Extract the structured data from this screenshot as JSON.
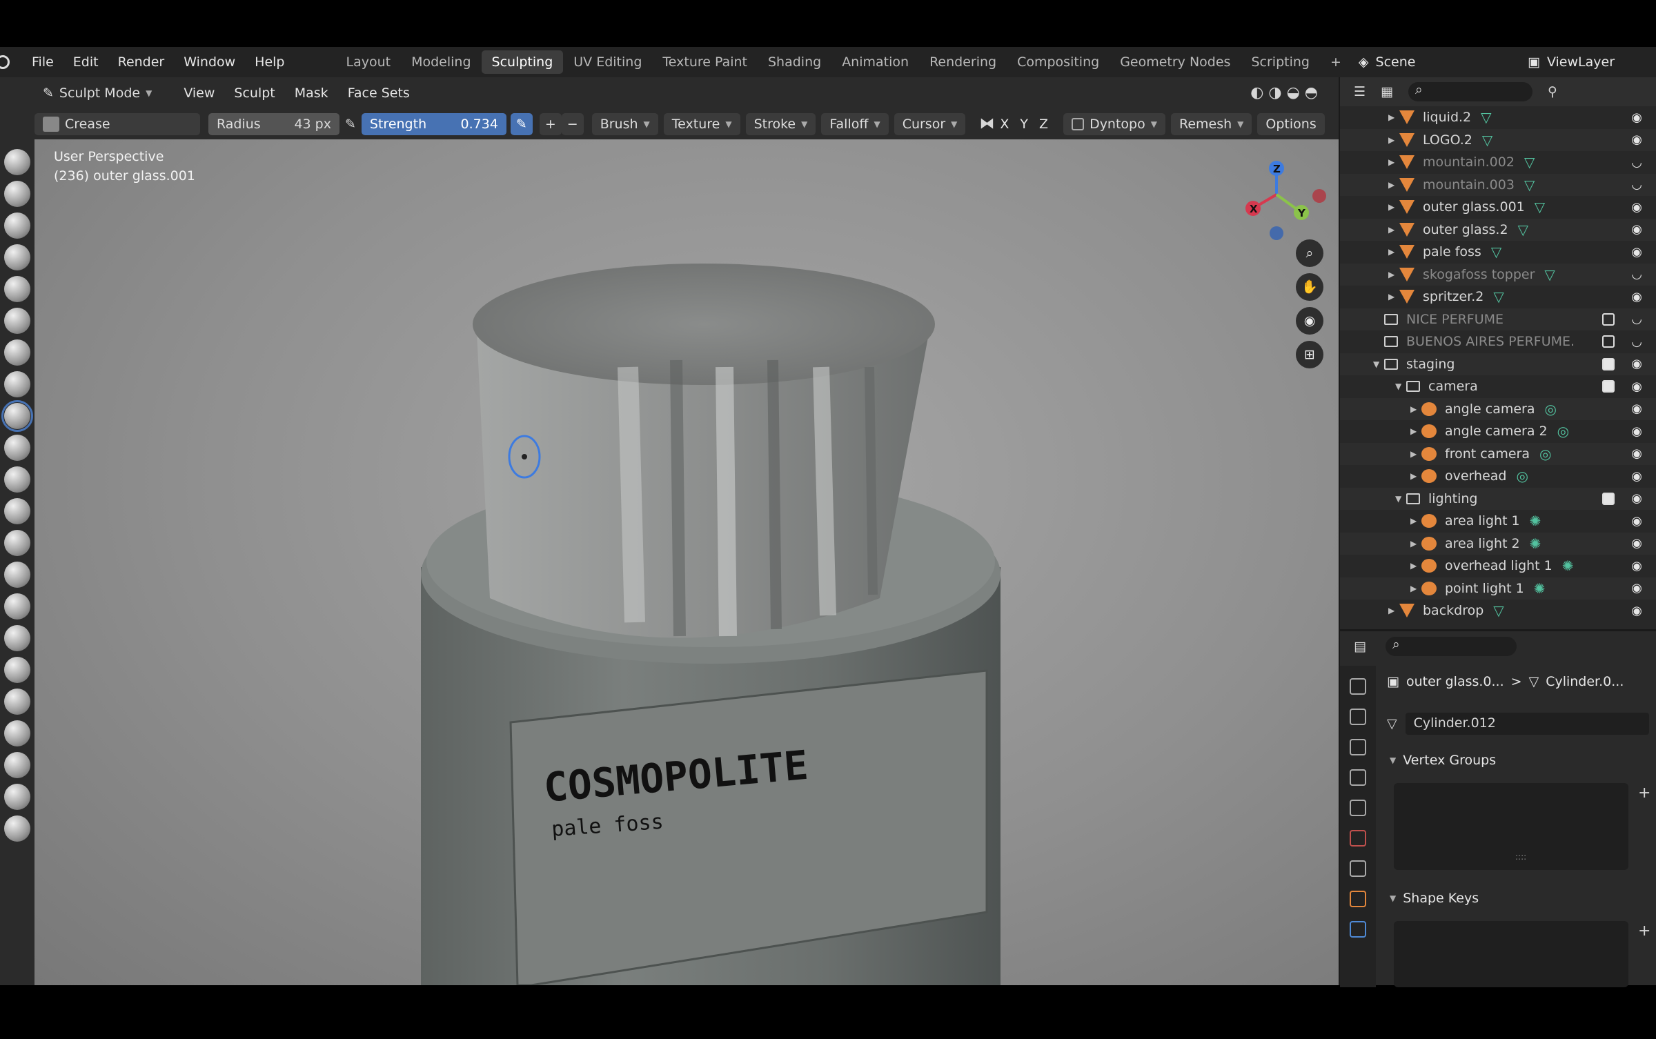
{
  "menubar": {
    "menus": [
      "File",
      "Edit",
      "Render",
      "Window",
      "Help"
    ],
    "workspaces": [
      "Layout",
      "Modeling",
      "Sculpting",
      "UV Editing",
      "Texture Paint",
      "Shading",
      "Animation",
      "Rendering",
      "Compositing",
      "Geometry Nodes",
      "Scripting"
    ],
    "active_workspace": "Sculpting",
    "add_tab": "+",
    "scene": "Scene",
    "view_layer": "ViewLayer"
  },
  "header": {
    "mode": "Sculpt Mode",
    "menus": [
      "View",
      "Sculpt",
      "Mask",
      "Face Sets"
    ]
  },
  "toolset": {
    "brush_name": "Crease",
    "radius_label": "Radius",
    "radius_value": "43 px",
    "strength_label": "Strength",
    "strength_value": "0.734",
    "plus": "+",
    "minus": "−",
    "dropdowns": [
      "Brush",
      "Texture",
      "Stroke",
      "Falloff",
      "Cursor"
    ],
    "axes": [
      "X",
      "Y",
      "Z"
    ],
    "dyntopo": "Dyntopo",
    "remesh": "Remesh",
    "options": "Options"
  },
  "viewport": {
    "view_name": "User Perspective",
    "object_info": "(236) outer glass.001",
    "label_title": "COSMOPOLITE",
    "label_subtitle": "pale foss",
    "gizmo": {
      "x": "X",
      "y": "Y",
      "z": "Z"
    }
  },
  "outliner": {
    "rows": [
      {
        "name": "liquid.2",
        "type": "mesh",
        "muted": false
      },
      {
        "name": "LOGO.2",
        "type": "mesh",
        "muted": false
      },
      {
        "name": "mountain.002",
        "type": "mesh",
        "muted": true
      },
      {
        "name": "mountain.003",
        "type": "mesh",
        "muted": true
      },
      {
        "name": "outer glass.001",
        "type": "mesh",
        "muted": false
      },
      {
        "name": "outer glass.2",
        "type": "mesh",
        "muted": false
      },
      {
        "name": "pale foss",
        "type": "mesh",
        "muted": false
      },
      {
        "name": "skogafoss topper",
        "type": "mesh",
        "muted": true
      },
      {
        "name": "spritzer.2",
        "type": "mesh",
        "muted": false
      },
      {
        "name": "NICE PERFUME",
        "type": "collection",
        "muted": true
      },
      {
        "name": "BUENOS AIRES PERFUME.",
        "type": "collection",
        "muted": true
      },
      {
        "name": "staging",
        "type": "collection",
        "muted": false
      },
      {
        "name": "camera",
        "type": "collection",
        "muted": false
      },
      {
        "name": "angle camera",
        "type": "camera",
        "muted": false
      },
      {
        "name": "angle camera  2",
        "type": "camera",
        "muted": false
      },
      {
        "name": "front camera",
        "type": "camera",
        "muted": false
      },
      {
        "name": "overhead",
        "type": "camera",
        "muted": false
      },
      {
        "name": "lighting",
        "type": "collection",
        "muted": false
      },
      {
        "name": "area light 1",
        "type": "light",
        "muted": false
      },
      {
        "name": "area light 2",
        "type": "light",
        "muted": false
      },
      {
        "name": "overhead light 1",
        "type": "light",
        "muted": false
      },
      {
        "name": "point light 1",
        "type": "light",
        "muted": false
      },
      {
        "name": "backdrop",
        "type": "mesh",
        "muted": false
      }
    ]
  },
  "properties": {
    "breadcrumb_object": "outer glass.0...",
    "breadcrumb_separator": ">",
    "breadcrumb_data": "Cylinder.0...",
    "mesh_name": "Cylinder.012",
    "vertex_groups": "Vertex Groups",
    "shape_keys": "Shape Keys",
    "plus": "+",
    "grip": "::::"
  },
  "colors": {
    "accent_blue": "#4772b3",
    "mesh_orange": "#e4873c",
    "data_green": "#53c3a0",
    "gizmo_x": "#d6394f",
    "gizmo_y": "#8bc34a",
    "gizmo_z": "#3d7be0"
  }
}
